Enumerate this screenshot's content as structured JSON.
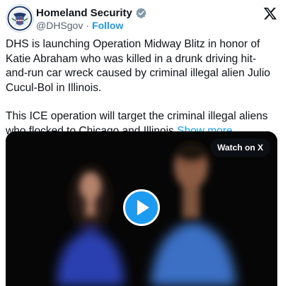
{
  "account": {
    "display_name": "Homeland Security",
    "handle": "@DHSgov",
    "separator": "·",
    "follow_label": "Follow",
    "verified": true,
    "avatar_icon": "dhs-seal-icon",
    "verified_icon": "gray-verified-badge-icon"
  },
  "brand": {
    "logo_icon": "x-logo-icon"
  },
  "tweet": {
    "paragraph_1": "DHS is launching Operation Midway Blitz in honor of Katie Abraham who was killed in a drunk driving hit-and-run car wreck caused by criminal illegal alien Julio Cucul-Bol in Illinois.",
    "paragraph_2": "This ICE operation will target the criminal illegal aliens who flocked to Chicago and Illinois",
    "show_more_label": "Show more"
  },
  "media": {
    "watch_label": "Watch on X",
    "play_icon": "play-icon"
  },
  "colors": {
    "accent": "#1d9bf0",
    "text": "#0f1419",
    "muted": "#536471",
    "verified_gray": "#829aab"
  }
}
